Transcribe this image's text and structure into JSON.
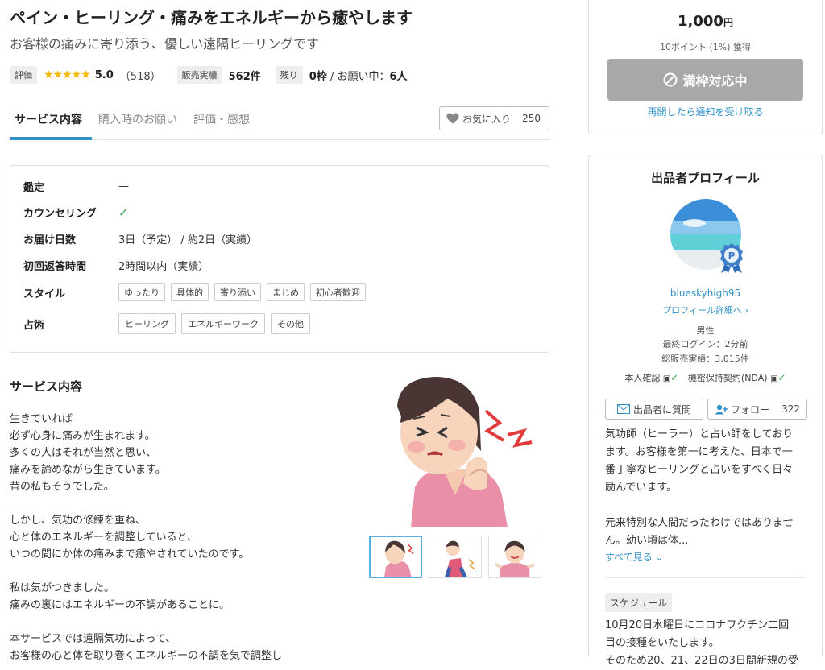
{
  "service": {
    "title": "ペイン・ヒーリング・痛みをエネルギーから癒やします",
    "subtitle": "お客様の痛みに寄り添う、優しい遠隔ヒーリングです"
  },
  "stats": {
    "rating_label": "評価",
    "stars": "★★★★★",
    "rating_value": "5.0",
    "rating_count": "（518）",
    "sales_label": "販売実績",
    "sales_value": "562件",
    "remaining_label": "残り",
    "remaining_value": "0枠",
    "remaining_suffix": " / お願い中：",
    "in_progress": "6人"
  },
  "tabs": [
    {
      "label": "サービス内容",
      "active": true
    },
    {
      "label": "購入時のお願い",
      "active": false
    },
    {
      "label": "評価・感想",
      "active": false
    }
  ],
  "favorite": {
    "label": "お気に入り",
    "count": "250"
  },
  "spec": {
    "appraisal_label": "鑑定",
    "appraisal_value": "—",
    "counseling_label": "カウンセリング",
    "delivery_label": "お届け日数",
    "delivery_value": "3日（予定） / 約2日（実績）",
    "reply_label": "初回返答時間",
    "reply_value": "2時間以内（実績）",
    "style_label": "スタイル",
    "styles": [
      "ゆったり",
      "具体的",
      "寄り添い",
      "まじめ",
      "初心者歓迎"
    ],
    "fortune_label": "占術",
    "fortunes": [
      "ヒーリング",
      "エネルギーワーク",
      "その他"
    ]
  },
  "description": {
    "heading": "サービス内容",
    "lines": [
      "生きていれば",
      "必ず心身に痛みが生まれます。",
      "多くの人はそれが当然と思い、",
      "痛みを諦めながら生きています。",
      "昔の私もそうでした。",
      "",
      "しかし、気功の修練を重ね、",
      "心と体のエネルギーを調整していると、",
      "いつの間にか体の痛みまで癒やされていたのです。",
      "",
      "私は気がつきました。",
      "痛みの裏にはエネルギーの不調があることに。",
      "",
      "本サービスでは遠隔気功によって、",
      "お客様の心と体を取り巻くエネルギーの不調を気で調整し"
    ]
  },
  "purchase": {
    "price": "1,000",
    "currency": "円",
    "points": "10ポイント (1%) 獲得",
    "button_label": "満枠対応中",
    "notify_label": "再開したら通知を受け取る"
  },
  "seller": {
    "heading": "出品者プロフィール",
    "username": "blueskyhigh95",
    "profile_link": "プロフィール詳細へ",
    "gender": "男性",
    "last_login": "最終ログイン：2分前",
    "total_sales": "総販売実績：3,015件",
    "identity_label": "本人確認",
    "nda_label": "機密保持契約(NDA)",
    "question_button": "出品者に質問",
    "follow_button": "フォロー",
    "follow_count": "322",
    "bio_lines": [
      "気功師（ヒーラー）と占い師をしており",
      "ます。お客様を第一に考えた、日本で一",
      "番丁寧なヒーリングと占いをすべく日々",
      "励んでいます。",
      "",
      "元来特別な人間だったわけではありませ",
      "ん。幼い頃は体..."
    ],
    "see_all": "すべて見る",
    "schedule_label": "スケジュール",
    "schedule_lines": [
      "10月20日水曜日にコロナワクチン二回",
      "目の接種をいたします。",
      "そのため20、21、22日の3日間新規の受"
    ]
  },
  "colors": {
    "accent": "#2f91c8",
    "star": "#f5b800",
    "check": "#3aa655",
    "disabled": "#a8a8a8"
  }
}
